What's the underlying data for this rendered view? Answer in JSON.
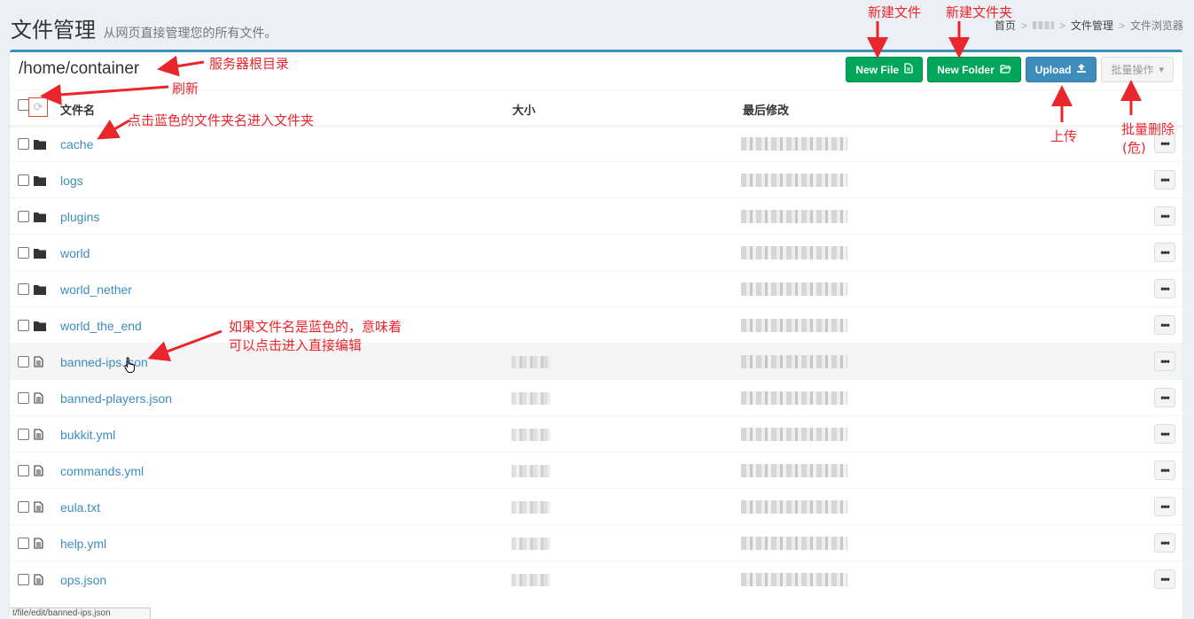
{
  "header": {
    "title": "文件管理",
    "subtitle": "从网页直接管理您的所有文件。",
    "breadcrumb": [
      "首页",
      "文件管理",
      "文件浏览器"
    ],
    "breadcrumb_sep": ">"
  },
  "path": "/home/container",
  "toolbar": {
    "new_file": "New File",
    "new_folder": "New Folder",
    "upload": "Upload",
    "bulk": "批量操作"
  },
  "table": {
    "col_name": "文件名",
    "col_size": "大小",
    "col_modified": "最后修改",
    "rows": [
      {
        "name": "cache",
        "type": "folder"
      },
      {
        "name": "logs",
        "type": "folder"
      },
      {
        "name": "plugins",
        "type": "folder"
      },
      {
        "name": "world",
        "type": "folder"
      },
      {
        "name": "world_nether",
        "type": "folder"
      },
      {
        "name": "world_the_end",
        "type": "folder"
      },
      {
        "name": "banned-ips.json",
        "type": "file"
      },
      {
        "name": "banned-players.json",
        "type": "file"
      },
      {
        "name": "bukkit.yml",
        "type": "file"
      },
      {
        "name": "commands.yml",
        "type": "file"
      },
      {
        "name": "eula.txt",
        "type": "file"
      },
      {
        "name": "help.yml",
        "type": "file"
      },
      {
        "name": "ops.json",
        "type": "file"
      }
    ]
  },
  "annotations": {
    "root_dir": "服务器根目录",
    "refresh": "刷新",
    "click_folder": "点击蓝色的文件夹名进入文件夹",
    "blue_file_line1": "如果文件名是蓝色的，意味着",
    "blue_file_line2": "可以点击进入直接编辑",
    "new_file": "新建文件",
    "new_folder": "新建文件夹",
    "upload": "上传",
    "bulk_delete_line1": "批量删除",
    "bulk_delete_line2": "(危)"
  },
  "status_url": "t/file/edit/banned-ips.json",
  "colors": {
    "accent": "#3c8dbc",
    "green": "#00a65a",
    "annotation": "#e8262c"
  }
}
